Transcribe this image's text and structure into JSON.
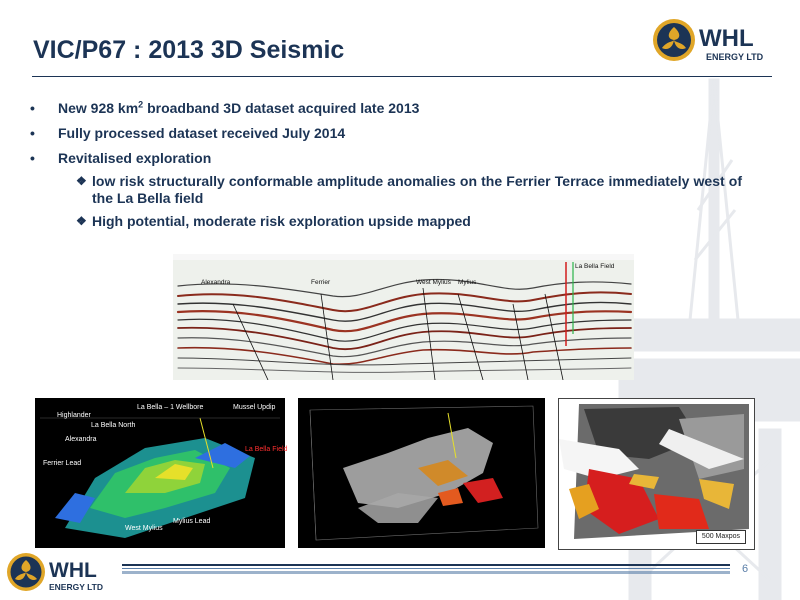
{
  "slide": {
    "title": "VIC/P67 : 2013 3D Seismic",
    "page_number": "6"
  },
  "logo": {
    "name": "WHL",
    "subtitle": "ENERGY LTD"
  },
  "bullets": {
    "item1_pre": "New 928 km",
    "item1_sup": "2",
    "item1_post": " broadband 3D dataset acquired late 2013",
    "item2": "Fully processed dataset received July 2014",
    "item3": "Revitalised exploration",
    "sub1": "low risk structurally conformable amplitude anomalies on the Ferrier Terrace immediately west of the La Bella field",
    "sub2": "High potential, moderate risk exploration upside mapped"
  },
  "seismic_labels": {
    "alexandra": "Alexandra",
    "ferrier": "Ferrier",
    "west_mylius": "West Mylius",
    "mylius": "Mylius",
    "la_bella_field": "La Bella Field"
  },
  "panel1_labels": {
    "highlander": "Highlander",
    "la_bella_1": "La Bella – 1 Wellbore",
    "mussel_updip": "Mussel Updip",
    "la_bella_north": "La Bella North",
    "alexandra": "Alexandra",
    "ferrier_lead": "Ferrier Lead",
    "la_bella_field": "La Bella Field",
    "mylius_lead": "Mylius Lead",
    "west_mylius": "West Mylius"
  },
  "panel3_labels": {
    "maxpos": "500 Maxpos"
  },
  "colors": {
    "navy": "#1c3455",
    "accent_blue": "#5a7ea8",
    "logo_gold": "#e0a628",
    "field_red": "#ff3030"
  }
}
